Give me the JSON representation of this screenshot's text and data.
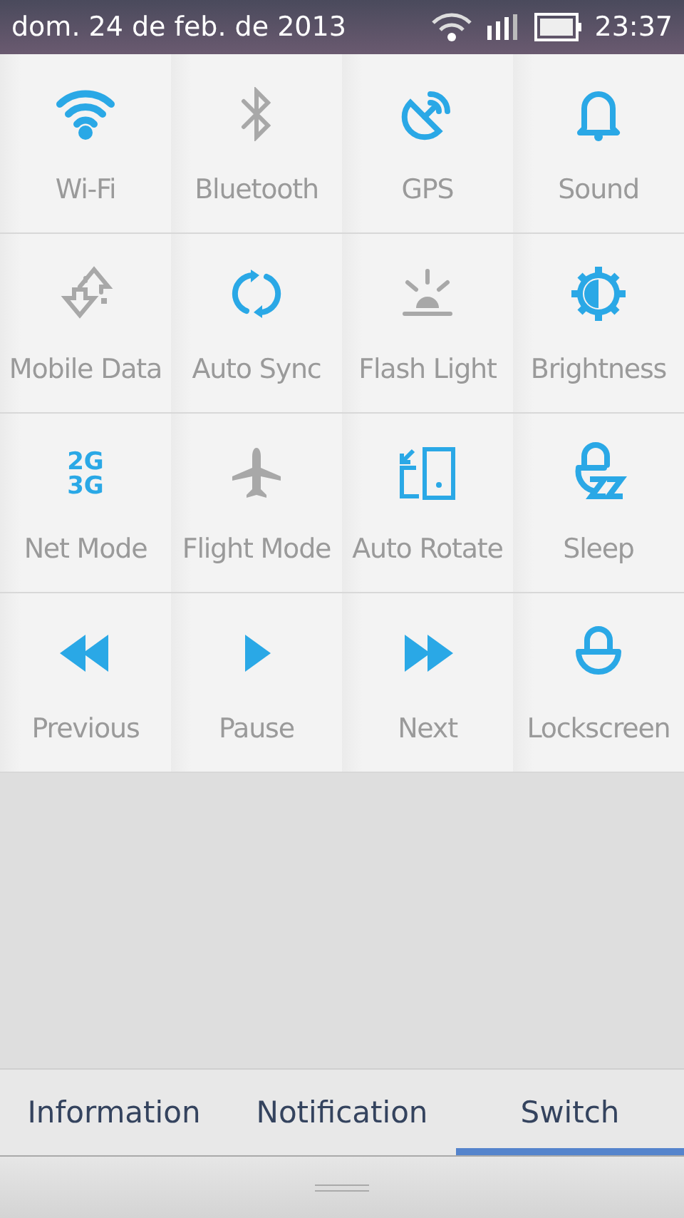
{
  "status_bar": {
    "date": "dom. 24 de feb. de 2013",
    "time": "23:37"
  },
  "toggles": [
    {
      "label": "Wi-Fi",
      "on": true
    },
    {
      "label": "Bluetooth",
      "on": false
    },
    {
      "label": "GPS",
      "on": true
    },
    {
      "label": "Sound",
      "on": true
    },
    {
      "label": "Mobile Data",
      "on": false
    },
    {
      "label": "Auto Sync",
      "on": true
    },
    {
      "label": "Flash Light",
      "on": false
    },
    {
      "label": "Brightness",
      "on": true
    },
    {
      "label": "Net Mode",
      "icon_text": [
        "2G",
        "3G"
      ],
      "on": true
    },
    {
      "label": "Flight Mode",
      "on": false
    },
    {
      "label": "Auto Rotate",
      "on": true
    },
    {
      "label": "Sleep",
      "on": true
    },
    {
      "label": "Previous",
      "on": true
    },
    {
      "label": "Pause",
      "on": true
    },
    {
      "label": "Next",
      "on": true
    },
    {
      "label": "Lockscreen",
      "on": true
    }
  ],
  "tabs": [
    {
      "label": "Information",
      "selected": false
    },
    {
      "label": "Notification",
      "selected": false
    },
    {
      "label": "Switch",
      "selected": true
    }
  ]
}
